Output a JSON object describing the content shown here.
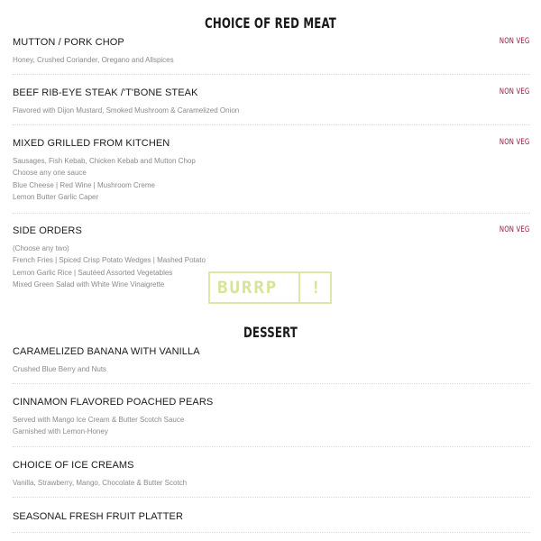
{
  "sections": {
    "red_meat": {
      "title": "CHOICE OF RED MEAT",
      "items": [
        {
          "name": "MUTTON / PORK CHOP",
          "tag": "NON VEG",
          "desc": [
            "Honey, Crushed Coriander, Oregano and Allspices"
          ]
        },
        {
          "name": "BEEF RIB-EYE STEAK /'T'BONE STEAK",
          "tag": "NON VEG",
          "desc": [
            "Flavored with Dijon Mustard, Smoked Mushroom & Caramelized Onion"
          ]
        },
        {
          "name": "MIXED GRILLED FROM KITCHEN",
          "tag": "NON VEG",
          "desc": [
            "Sausages, Fish Kebab, Chicken Kebab and Mutton Chop",
            "Choose any one sauce",
            "Blue Cheese | Red Wine | Mushroom Creme",
            "Lemon Butter Garlic Caper"
          ]
        },
        {
          "name": "SIDE ORDERS",
          "tag": "NON VEG",
          "desc": [
            "(Choose any two)",
            "French Fries | Spiced Crisp Potato Wedges | Mashed Potato",
            "Lemon Garlic Rice | Sautéed Assorted Vegetables",
            "Mixed Green Salad with White Wine Vinaigrette"
          ]
        }
      ]
    },
    "dessert": {
      "title": "DESSERT",
      "items": [
        {
          "name": "CARAMELIZED BANANA WITH VANILLA",
          "desc": [
            "Crushed Blue Berry and Nuts"
          ]
        },
        {
          "name": "CINNAMON FLAVORED POACHED PEARS",
          "desc": [
            "Served with Mango Ice Cream & Butter Scotch Sauce",
            "Garnished with Lemon-Honey"
          ]
        },
        {
          "name": "CHOICE OF ICE CREAMS",
          "desc": [
            "Vanilla, Strawberry, Mango, Chocolate & Butter Scotch"
          ]
        },
        {
          "name": "SEASONAL FRESH FRUIT PLATTER",
          "desc": []
        }
      ]
    }
  },
  "watermark": {
    "text": "BURRP",
    "mark": "!",
    "color": "#dfe7a8"
  },
  "colors": {
    "tag": "#8c1a3c",
    "desc": "#8a8a8a"
  }
}
